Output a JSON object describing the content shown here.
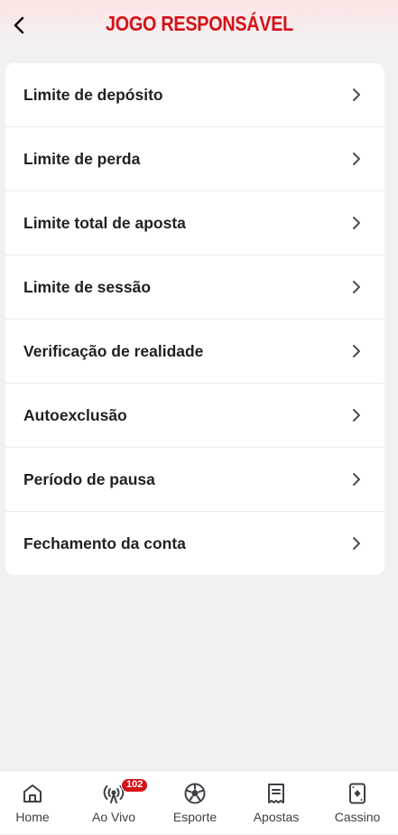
{
  "header": {
    "title": "JOGO RESPONSÁVEL",
    "back_icon": "chevron-left-icon"
  },
  "menu": {
    "items": [
      {
        "label": "Limite de depósito"
      },
      {
        "label": "Limite de perda"
      },
      {
        "label": "Limite total de aposta"
      },
      {
        "label": "Limite de sessão"
      },
      {
        "label": "Verificação de realidade"
      },
      {
        "label": "Autoexclusão"
      },
      {
        "label": "Período de pausa"
      },
      {
        "label": "Fechamento da conta"
      }
    ]
  },
  "tabbar": {
    "tabs": [
      {
        "label": "Home",
        "icon": "home-icon"
      },
      {
        "label": "Ao Vivo",
        "icon": "live-broadcast-icon",
        "badge": "102"
      },
      {
        "label": "Esporte",
        "icon": "soccer-ball-icon"
      },
      {
        "label": "Apostas",
        "icon": "bet-slip-icon"
      },
      {
        "label": "Cassino",
        "icon": "playing-card-icon"
      }
    ]
  },
  "colors": {
    "accent": "#d3121a",
    "background": "#f0f1f3",
    "text": "#1f2024"
  }
}
